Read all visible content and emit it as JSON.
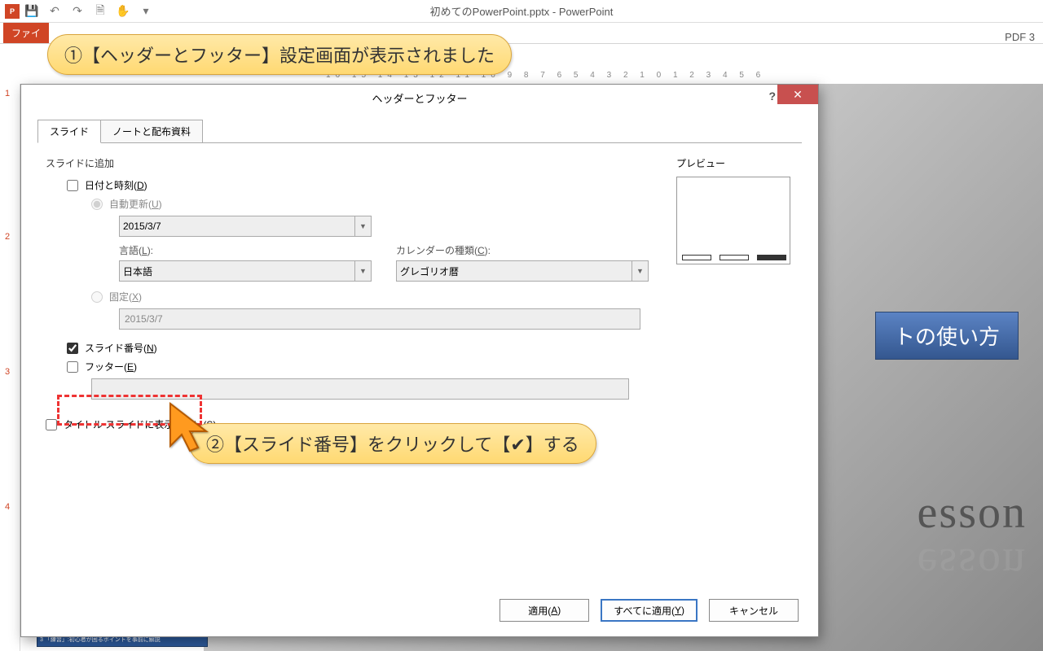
{
  "titlebar": {
    "filename": "初めてのPowerPoint.pptx - PowerPoint"
  },
  "ribbon": {
    "file_tab": "ファイ",
    "right_fragment": "PDF 3"
  },
  "callout1": "①【ヘッダーとフッター】設定画面が表示されました",
  "callout2": "②【スライド番号】をクリックして【✔】する",
  "ruler": "16  15  14  13  12  11  10  9  8  7  6  5  4  3  2  1  0  1  2  3  4  5  6",
  "thumbs": {
    "n1": "1",
    "n2": "2",
    "n3": "3",
    "n4": "4"
  },
  "slide_area": {
    "title_fragment": "トの使い方",
    "lesson": "esson"
  },
  "thumb_strip": "3 「練習」:初心者が困るポイントを事前に解説",
  "dialog": {
    "title": "ヘッダーとフッター",
    "help": "?",
    "close": "✕",
    "tab_slide": "スライド",
    "tab_notes": "ノートと配布資料",
    "group_add": "スライドに追加",
    "date_label_pre": "日付と時刻(",
    "date_label_key": "D",
    "date_label_post": ")",
    "auto_label_pre": "自動更新(",
    "auto_label_key": "U",
    "auto_label_post": ")",
    "auto_date_value": "2015/3/7",
    "lang_label_pre": "言語(",
    "lang_label_key": "L",
    "lang_label_post": "):",
    "lang_value": "日本語",
    "cal_label_pre": "カレンダーの種類(",
    "cal_label_key": "C",
    "cal_label_post": "):",
    "cal_value": "グレゴリオ暦",
    "fixed_label_pre": "固定(",
    "fixed_label_key": "X",
    "fixed_label_post": ")",
    "fixed_value": "2015/3/7",
    "slideno_label_pre": "スライド番号(",
    "slideno_label_key": "N",
    "slideno_label_post": ")",
    "footer_label_pre": "フッター(",
    "footer_label_key": "E",
    "footer_label_post": ")",
    "footer_value": "",
    "hide_title_pre": "タイトル スライドに表示しない(",
    "hide_title_key": "S",
    "hide_title_post": ")",
    "preview_label": "プレビュー",
    "btn_apply_pre": "適用(",
    "btn_apply_key": "A",
    "btn_apply_post": ")",
    "btn_apply_all_pre": "すべてに適用(",
    "btn_apply_all_key": "Y",
    "btn_apply_all_post": ")",
    "btn_cancel": "キャンセル"
  }
}
